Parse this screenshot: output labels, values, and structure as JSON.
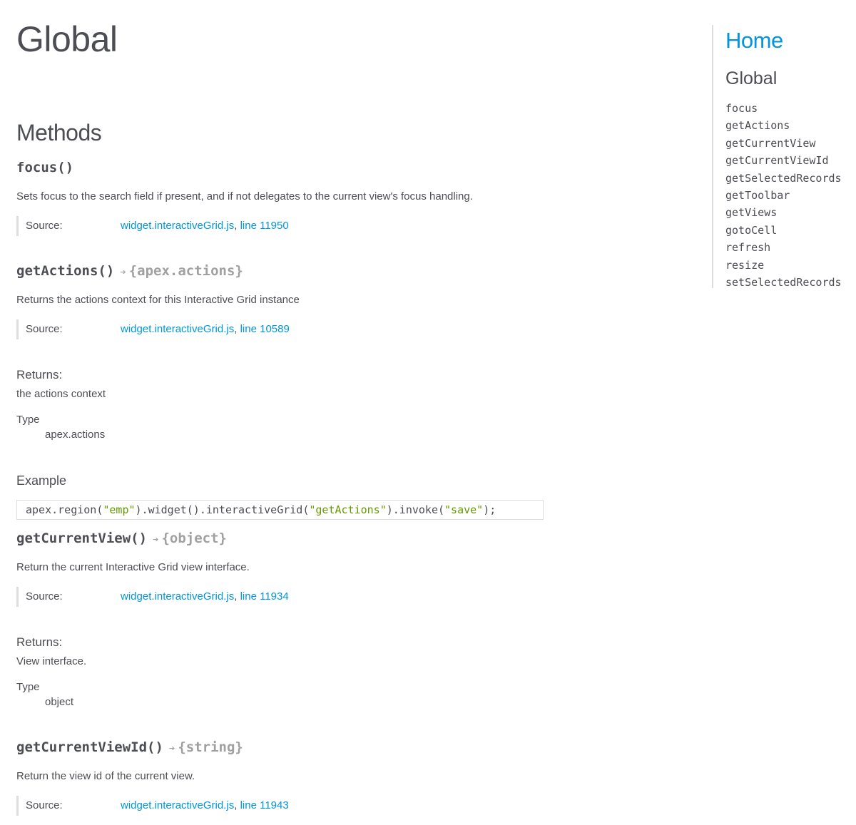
{
  "page": {
    "title": "Global"
  },
  "section": {
    "title": "Methods"
  },
  "methods": [
    {
      "signature": "focus()",
      "description": "Sets focus to the search field if present, and if not delegates to the current view's focus handling.",
      "source": {
        "label": "Source:",
        "file": "widget.interactiveGrid.js",
        "separator": ",",
        "line": "line 11950"
      }
    },
    {
      "signature": "getActions()",
      "arrow": "➔",
      "return_type": "{apex.actions}",
      "description": "Returns the actions context for this Interactive Grid instance",
      "source": {
        "label": "Source:",
        "file": "widget.interactiveGrid.js",
        "separator": ",",
        "line": "line 10589"
      },
      "returns": {
        "heading": "Returns:",
        "text": "the actions context",
        "type_label": "Type",
        "type_value": "apex.actions"
      },
      "example": {
        "heading": "Example",
        "code_parts": [
          "apex.region(",
          "\"emp\"",
          ").widget().interactiveGrid(",
          "\"getActions\"",
          ").invoke(",
          "\"save\"",
          ");"
        ]
      }
    },
    {
      "signature": "getCurrentView()",
      "arrow": "➔",
      "return_type": "{object}",
      "description": "Return the current Interactive Grid view interface.",
      "source": {
        "label": "Source:",
        "file": "widget.interactiveGrid.js",
        "separator": ",",
        "line": "line 11934"
      },
      "returns": {
        "heading": "Returns:",
        "text": "View interface.",
        "type_label": "Type",
        "type_value": "object"
      }
    },
    {
      "signature": "getCurrentViewId()",
      "arrow": "➔",
      "return_type": "{string}",
      "description": "Return the view id of the current view.",
      "source": {
        "label": "Source:",
        "file": "widget.interactiveGrid.js",
        "separator": ",",
        "line": "line 11943"
      }
    }
  ],
  "sidebar": {
    "home": "Home",
    "heading": "Global",
    "items": [
      "focus",
      "getActions",
      "getCurrentView",
      "getCurrentViewId",
      "getSelectedRecords",
      "getToolbar",
      "getViews",
      "gotoCell",
      "refresh",
      "resize",
      "setSelectedRecords"
    ]
  }
}
